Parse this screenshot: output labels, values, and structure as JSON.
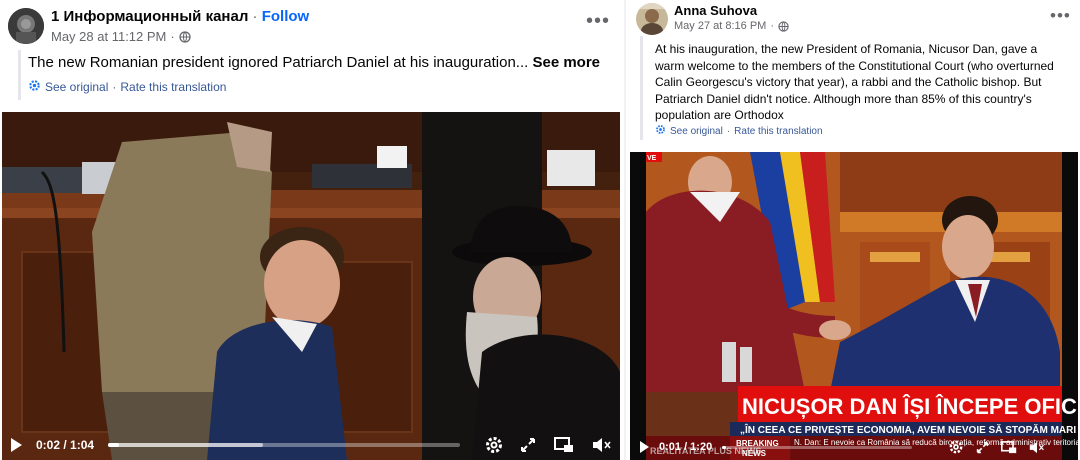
{
  "left_post": {
    "author": "1 Информационный канал",
    "separator": " · ",
    "follow_label": "Follow",
    "timestamp": "May 28 at 11:12 PM",
    "audience_icon": "globe-icon",
    "text": "The new Romanian president ignored Patriarch Daniel at his inauguration...",
    "see_more_label": "See more",
    "see_original_label": "See original",
    "translate_separator": " · ",
    "rate_translation_label": "Rate this translation",
    "video": {
      "time_label": "0:02 / 1:04",
      "progress": 0.03,
      "buffered": 0.44
    }
  },
  "right_post": {
    "author": "Anna Suhova",
    "timestamp": "May 27 at 8:16 PM",
    "audience_icon": "globe-icon",
    "text": "At his inauguration, the new President of Romania, Nicusor Dan, gave a warm welcome to the members of the Constitutional Court (who overturned Calin Georgescu's victory that year), a rabbi and the Catholic bishop. But Patriarch Daniel didn't notice. Although more than 85% of this country's population are Orthodox",
    "see_original_label": "See original",
    "translate_separator": " · ",
    "rate_translation_label": "Rate this translation",
    "video": {
      "live_label": "VE",
      "headline": "NICUȘOR DAN ÎȘI ÎNCEPE OFICIAL",
      "subline": "„ÎN CEEA CE PRIVEȘTE ECONOMIA, AVEM NEVOIE SĂ STOPĂM MARI",
      "breaking_label": "BREAKING",
      "news_label": "NEWS",
      "ticker_text": "N. Dan: E nevoie ca România să reducă birocrația, reformă administrativ teritorială și o reformă a s",
      "channel_label": "REALITATEA PLUS NEWS",
      "time_label": "0:01 / 1:20",
      "progress": 0.02
    }
  },
  "colors": {
    "link_blue": "#385898",
    "follow_blue": "#0866ff",
    "meta_gray": "#65676b",
    "news_red": "#e10e0e"
  }
}
